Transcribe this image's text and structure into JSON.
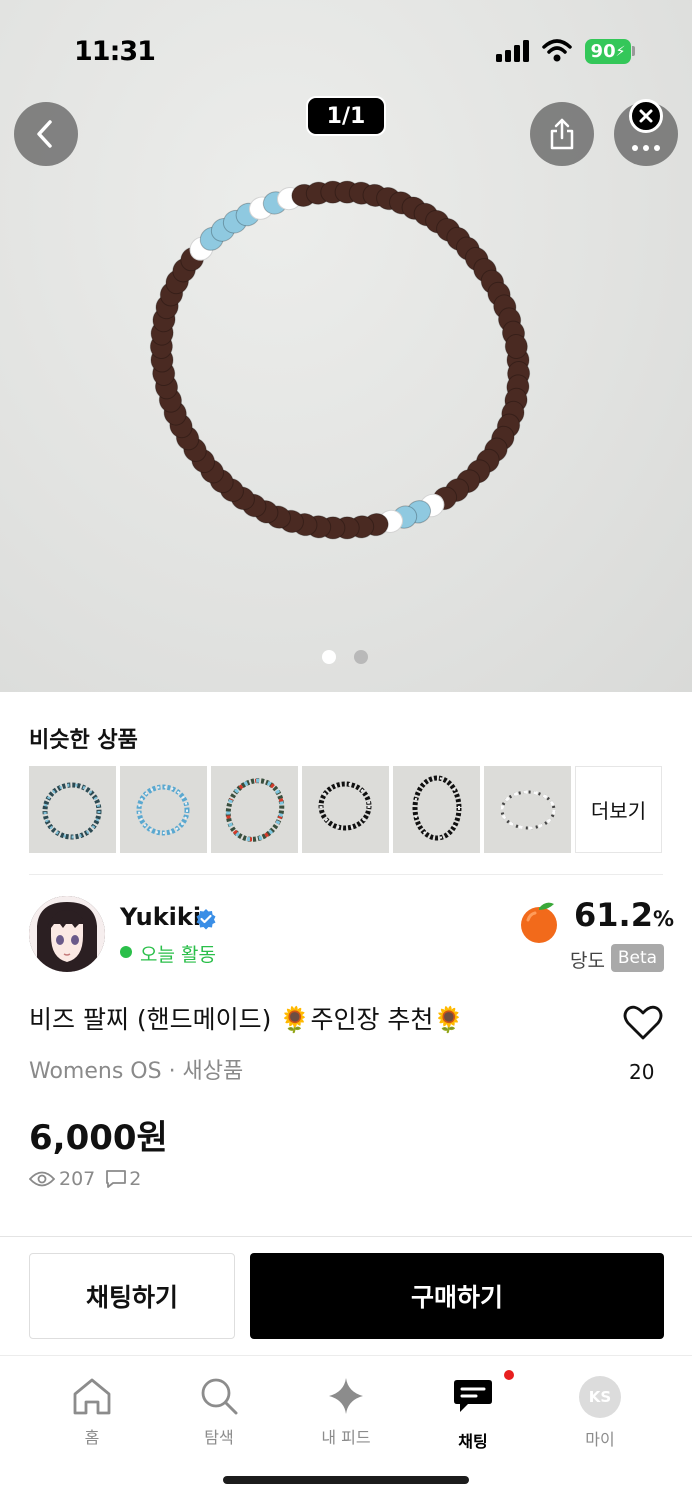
{
  "status_bar": {
    "time": "11:31",
    "battery": "90"
  },
  "gallery": {
    "counter": "1/1",
    "page_count": 2,
    "current_page": 1
  },
  "similar": {
    "title": "비슷한 상품",
    "more_label": "더보기",
    "items": [
      "bracelet-1",
      "bracelet-2",
      "bracelet-3",
      "bracelet-4",
      "bracelet-5",
      "bracelet-6"
    ]
  },
  "seller": {
    "name": "Yukiki",
    "activity": "오늘 활동",
    "score": "61.2",
    "score_unit": "%",
    "score_label": "당도",
    "beta": "Beta"
  },
  "product": {
    "title": "비즈 팔찌 (핸드메이드) 🌻주인장 추천🌻",
    "category": "Womens OS · 새상품",
    "price": "6,000원",
    "views": "207",
    "chats": "2",
    "likes": "20"
  },
  "actions": {
    "chat": "채팅하기",
    "buy": "구매하기"
  },
  "tabs": [
    {
      "label": "홈",
      "icon": "home-icon"
    },
    {
      "label": "탐색",
      "icon": "search-icon"
    },
    {
      "label": "내 피드",
      "icon": "sparkle-icon"
    },
    {
      "label": "채팅",
      "icon": "chat-icon"
    },
    {
      "label": "마이",
      "icon": "profile-icon",
      "initials": "KS"
    }
  ],
  "colors": {
    "accent_green": "#2bbf4a",
    "bead_brown": "#4a2a22",
    "bead_blue": "#8fc9e0",
    "badge_red": "#e81f1f"
  }
}
